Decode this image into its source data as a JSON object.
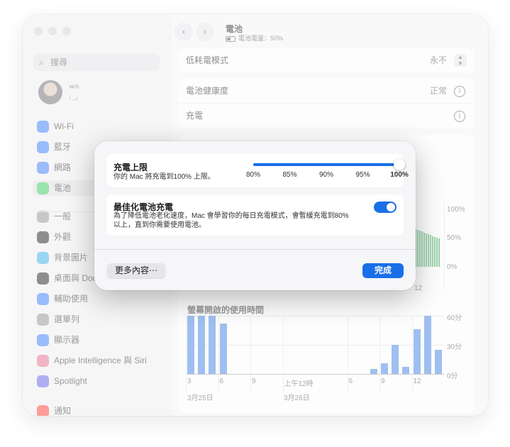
{
  "window": {
    "title": "電池",
    "subtitle": "電池電量：50%",
    "nav_back": "‹",
    "nav_forward": "›"
  },
  "sidebar": {
    "search_placeholder": "搜尋",
    "user_name": "ʷᶜʰ",
    "user_sub": "ᵢ ˍˍᵣ",
    "items": [
      {
        "label": "Wi-Fi",
        "icon": "wifi-icon",
        "color": "#3478f6"
      },
      {
        "label": "藍牙",
        "icon": "bluetooth-icon",
        "color": "#3478f6"
      },
      {
        "label": "網路",
        "icon": "globe-icon",
        "color": "#3478f6"
      },
      {
        "label": "電池",
        "icon": "battery-icon",
        "color": "#34c759"
      },
      {
        "label": "一般",
        "icon": "gear-icon",
        "color": "#8e8e93"
      },
      {
        "label": "外觀",
        "icon": "appearance-icon",
        "color": "#1c1c1e"
      },
      {
        "label": "背景圖片",
        "icon": "wallpaper-icon",
        "color": "#32ade6"
      },
      {
        "label": "桌面與 Doc",
        "icon": "dock-icon",
        "color": "#1c1c1e"
      },
      {
        "label": "輔助使用",
        "icon": "accessibility-icon",
        "color": "#3478f6"
      },
      {
        "label": "選單列",
        "icon": "menubar-icon",
        "color": "#8e8e93"
      },
      {
        "label": "顯示器",
        "icon": "display-icon",
        "color": "#3478f6"
      },
      {
        "label": "Apple Intelligence 與 Siri",
        "icon": "siri-icon",
        "color": "#e46a8c"
      },
      {
        "label": "Spotlight",
        "icon": "spotlight-icon",
        "color": "#5e5ce6"
      },
      {
        "label": "通知",
        "icon": "notifications-icon",
        "color": "#ff3b30"
      }
    ]
  },
  "main": {
    "low_power_label": "低耗電模式",
    "low_power_value": "永不",
    "health_label": "電池健康度",
    "health_value": "正常",
    "charging_label": "充電",
    "info_glyph": "i",
    "level_axis": [
      "100%",
      "50%",
      "0%"
    ],
    "level_time_tick": "12",
    "screen_title": "螢幕開啟的使用時間",
    "usage_axis": [
      "60分",
      "30分",
      "0分"
    ],
    "time_ticks": [
      "3",
      "6",
      "9",
      "上午12時",
      "6",
      "9",
      "12"
    ],
    "dates": [
      "3月25日",
      "3月26日"
    ]
  },
  "usage_chart_data": {
    "type": "bar",
    "unit": "分",
    "ylim": [
      0,
      60
    ],
    "values": [
      60,
      60,
      60,
      52,
      0,
      0,
      0,
      0,
      0,
      0,
      0,
      0,
      0,
      0,
      0,
      0,
      0,
      5,
      11,
      30,
      7,
      46,
      60,
      25
    ]
  },
  "sheet": {
    "limit_title": "充電上限",
    "limit_desc": "你的 Mac 將充電到100% 上限。",
    "slider_ticks": [
      "80%",
      "85%",
      "90%",
      "95%",
      "100%"
    ],
    "slider_value_percent": 100,
    "optimize_title": "最佳化電池充電",
    "optimize_desc_1": "為了降低電池老化速度，Mac 會學習你的每日充電模式，會暫緩充電到80%",
    "optimize_desc_2": "以上，直到你需要使用電池。",
    "optimize_on": true,
    "more_button": "更多內容⋯",
    "done_button": "完成"
  },
  "colors": {
    "accent": "#1a6fe8",
    "chart_bar": "#3d7fe0",
    "level_bar": "#3aa45a"
  }
}
